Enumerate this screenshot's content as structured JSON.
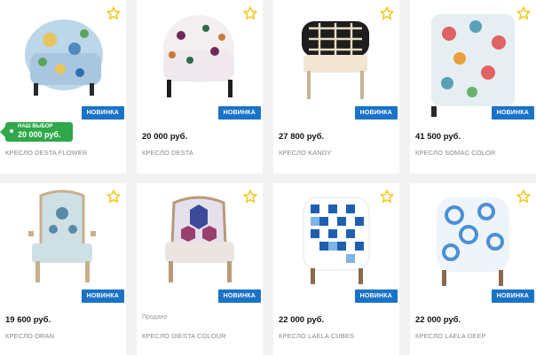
{
  "labels": {
    "new_badge": "НОВИНКА",
    "sold": "Продано"
  },
  "colors": {
    "accent_blue": "#1a73c7",
    "choice_green": "#2ea84a",
    "star_yellow": "#f5c518"
  },
  "products": [
    {
      "name": "КРЕСЛО DESTA FLOWER",
      "price": "",
      "tag": {
        "label": "НАШ ВЫБОР",
        "amount": "20 000 руб."
      },
      "icon": "star-icon"
    },
    {
      "name": "КРЕСЛО DESTA",
      "price": "20 000 руб.",
      "icon": "star-icon"
    },
    {
      "name": "КРЕСЛО KANDY",
      "price": "27 800 руб.",
      "icon": "star-icon"
    },
    {
      "name": "КРЕСЛО SOMAC COLOR",
      "price": "41 500 руб.",
      "icon": "star-icon"
    },
    {
      "name": "КРЕСЛО ORAN",
      "price": "19 600 руб.",
      "icon": "star-icon"
    },
    {
      "name": "КРЕСЛО DIESTA COLOUR",
      "price": "",
      "status": "Продано",
      "icon": "star-icon"
    },
    {
      "name": "КРЕСЛО LAELA CUBES",
      "price": "22 000 руб.",
      "icon": "star-icon"
    },
    {
      "name": "КРЕСЛО LAELA DEEP",
      "price": "22 000 руб.",
      "icon": "star-icon"
    }
  ]
}
